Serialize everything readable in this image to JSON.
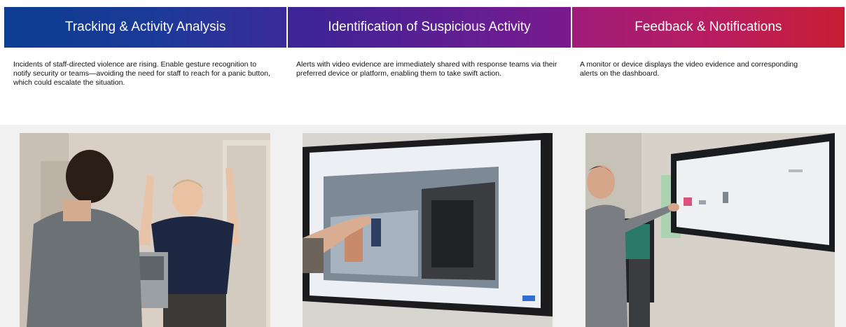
{
  "columns": [
    {
      "title": "Tracking & Activity Analysis",
      "description": "Incidents of staff-directed violence are rising. Enable gesture recognition to notify security or teams—avoiding the need for staff to reach for a panic button, which could escalate the situation."
    },
    {
      "title": "Identification of Suspicious Activity",
      "description": "Alerts with video evidence are immediately shared with response teams via their preferred device or platform, enabling them to take swift action."
    },
    {
      "title": "Feedback & Notifications",
      "description": "A monitor or device displays the video evidence and corresponding alerts on the dashboard."
    }
  ],
  "colors": {
    "header_blue": "#0b3d91",
    "header_purple": "#5d1f93",
    "header_red": "#c81e34"
  }
}
